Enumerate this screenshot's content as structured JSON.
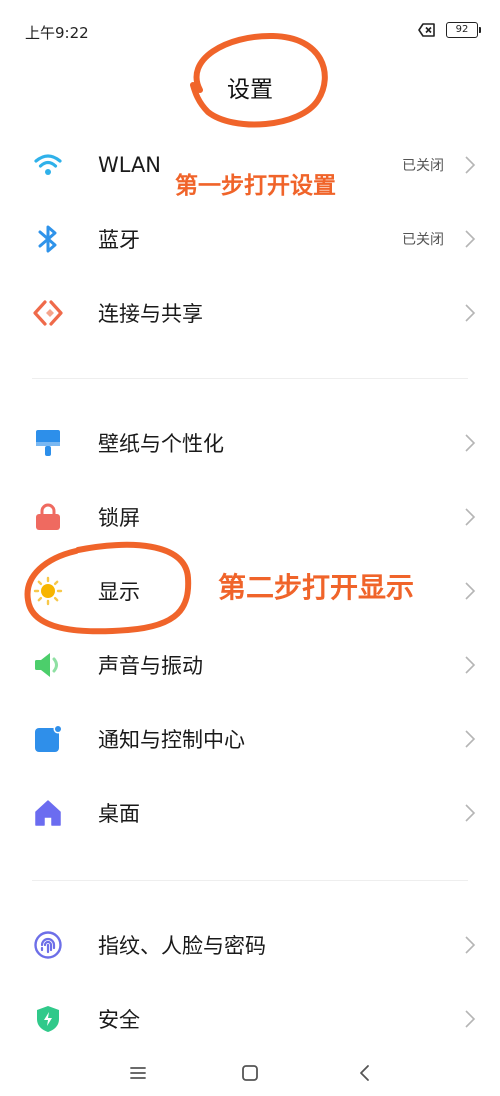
{
  "status_bar": {
    "time": "上午9:22",
    "battery": "92",
    "icons": [
      "sim-off-icon",
      "battery-icon"
    ]
  },
  "header": {
    "title": "设置"
  },
  "sections": [
    {
      "items": [
        {
          "label": "WLAN",
          "value": "已关闭",
          "icon": "wifi-icon",
          "color": "#2fb1ea"
        },
        {
          "label": "蓝牙",
          "value": "已关闭",
          "icon": "bluetooth-icon",
          "color": "#2f93ea"
        },
        {
          "label": "连接与共享",
          "value": "",
          "icon": "share-icon",
          "color": "#ef6a4a"
        }
      ]
    },
    {
      "items": [
        {
          "label": "壁纸与个性化",
          "value": "",
          "icon": "paintbrush-icon",
          "color": "#2d8fea"
        },
        {
          "label": "锁屏",
          "value": "",
          "icon": "lock-icon",
          "color": "#ef6a60"
        },
        {
          "label": "显示",
          "value": "",
          "icon": "sun-icon",
          "color": "#f7b500"
        },
        {
          "label": "声音与振动",
          "value": "",
          "icon": "speaker-icon",
          "color": "#4cce6b"
        },
        {
          "label": "通知与控制中心",
          "value": "",
          "icon": "notification-icon",
          "color": "#2f8fea"
        },
        {
          "label": "桌面",
          "value": "",
          "icon": "home-icon",
          "color": "#6b6cf0"
        }
      ]
    },
    {
      "items": [
        {
          "label": "指纹、人脸与密码",
          "value": "",
          "icon": "fingerprint-icon",
          "color": "#6d6fe8"
        },
        {
          "label": "安全",
          "value": "",
          "icon": "shield-icon",
          "color": "#30c98a"
        }
      ]
    }
  ],
  "annotations": {
    "step1": "第一步打开设置",
    "step2": "第二步打开显示",
    "color": "#f0642a"
  },
  "nav_bar": {
    "icons": [
      "menu-icon",
      "home-square-icon",
      "back-icon"
    ]
  }
}
